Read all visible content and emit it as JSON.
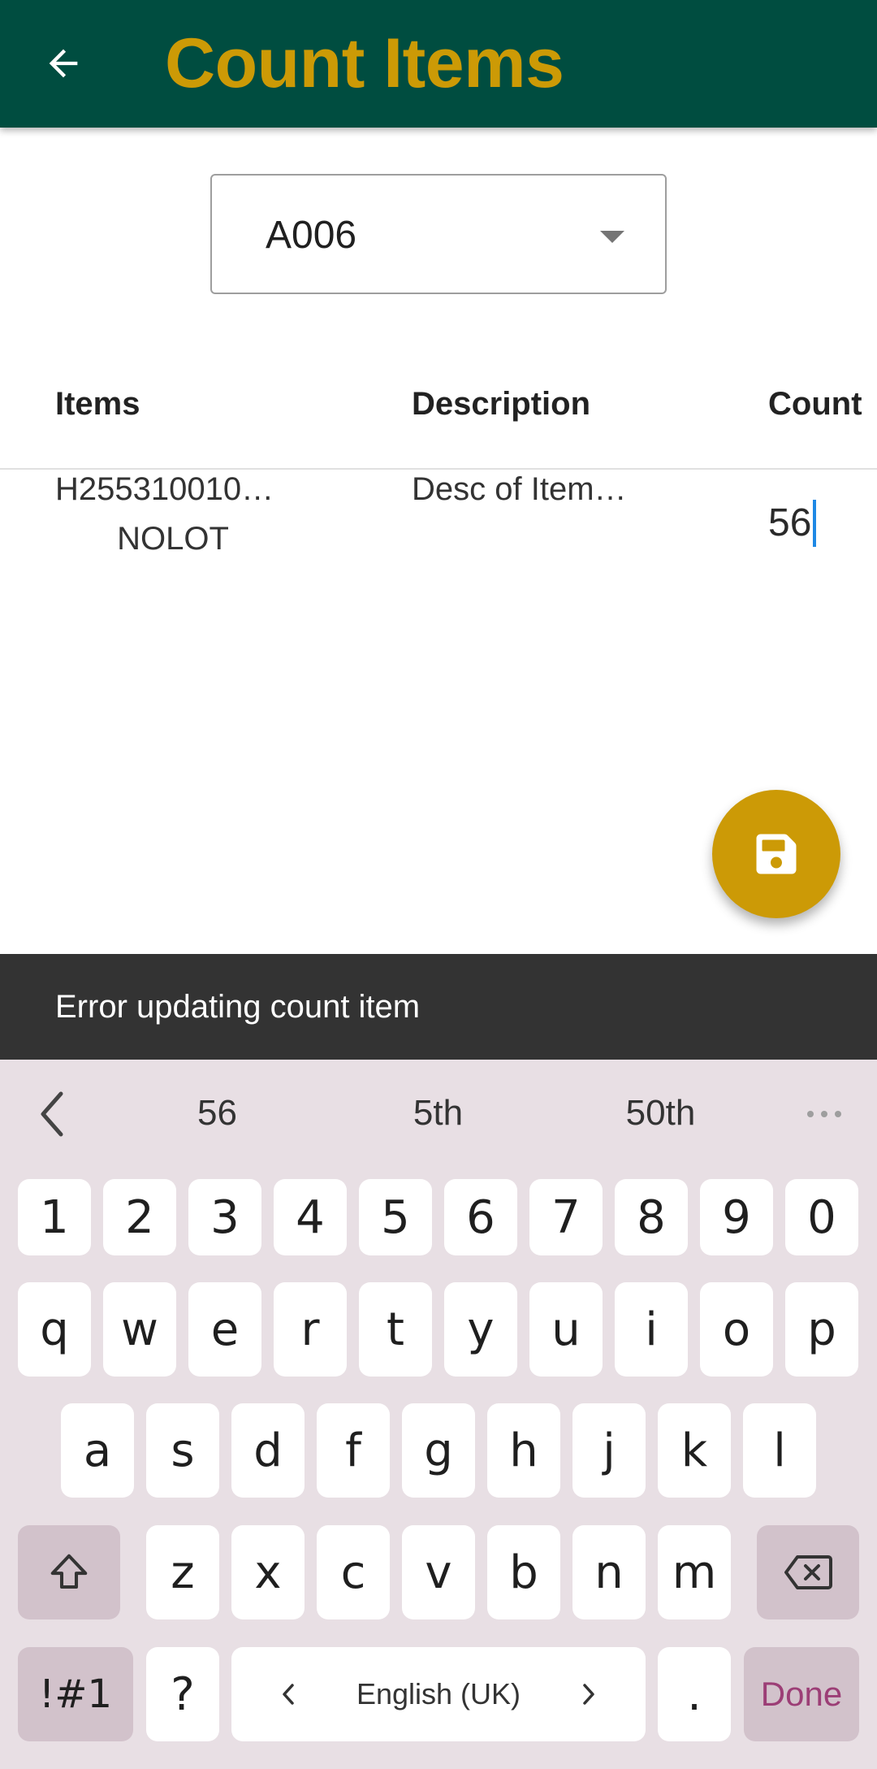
{
  "app_bar": {
    "title": "Count Items",
    "back_icon": "arrow-back-icon",
    "background_color": "#004d40",
    "title_color": "#cc9a06"
  },
  "location_select": {
    "value": "A006",
    "icon": "dropdown-arrow-icon"
  },
  "table": {
    "headers": [
      "Items",
      "Description",
      "Count"
    ],
    "rows": [
      {
        "item": "H255310010…",
        "lot": "NOLOT",
        "description": "Desc of Item…",
        "count": "56"
      }
    ]
  },
  "fab": {
    "icon": "save-icon",
    "color": "#cc9a06"
  },
  "snackbar": {
    "message": "Error updating count item"
  },
  "keyboard": {
    "suggestions": [
      "56",
      "5th",
      "50th"
    ],
    "row_numbers": [
      "1",
      "2",
      "3",
      "4",
      "5",
      "6",
      "7",
      "8",
      "9",
      "0"
    ],
    "row_top": [
      "q",
      "w",
      "e",
      "r",
      "t",
      "y",
      "u",
      "i",
      "o",
      "p"
    ],
    "row_middle": [
      "a",
      "s",
      "d",
      "f",
      "g",
      "h",
      "j",
      "k",
      "l"
    ],
    "row_bottom": [
      "z",
      "x",
      "c",
      "v",
      "b",
      "n",
      "m"
    ],
    "symbols_key": "!#1",
    "question_key": "?",
    "space_label": "English (UK)",
    "period_key": ".",
    "done_key": "Done",
    "accent_color": "#9c3e76"
  }
}
